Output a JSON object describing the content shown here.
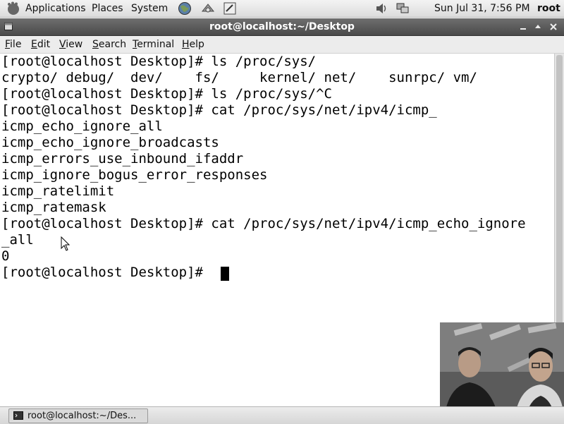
{
  "top_panel": {
    "menus": [
      "Applications",
      "Places",
      "System"
    ],
    "clock": "Sun Jul 31,  7:56 PM",
    "user": "root"
  },
  "window": {
    "title": "root@localhost:~/Desktop",
    "menu": [
      {
        "label": "File",
        "u": "F",
        "rest": "ile"
      },
      {
        "label": "Edit",
        "u": "E",
        "rest": "dit"
      },
      {
        "label": "View",
        "u": "V",
        "rest": "iew"
      },
      {
        "label": "Search",
        "u": "S",
        "rest": "earch"
      },
      {
        "label": "Terminal",
        "u": "T",
        "rest": "erminal"
      },
      {
        "label": "Help",
        "u": "H",
        "rest": "elp"
      }
    ]
  },
  "terminal": {
    "lines": [
      "[root@localhost Desktop]# ls /proc/sys/",
      "crypto/ debug/  dev/    fs/     kernel/ net/    sunrpc/ vm/",
      "[root@localhost Desktop]# ls /proc/sys/^C",
      "[root@localhost Desktop]# cat /proc/sys/net/ipv4/icmp_",
      "icmp_echo_ignore_all",
      "icmp_echo_ignore_broadcasts",
      "icmp_errors_use_inbound_ifaddr",
      "icmp_ignore_bogus_error_responses",
      "icmp_ratelimit",
      "icmp_ratemask",
      "[root@localhost Desktop]# cat /proc/sys/net/ipv4/icmp_echo_ignore",
      "_all",
      "0",
      "[root@localhost Desktop]# "
    ]
  },
  "taskbar": {
    "task_label": "root@localhost:~/Des..."
  },
  "colors": {
    "titlebar": "#555555",
    "terminal_bg": "#ffffff",
    "terminal_fg": "#000000"
  }
}
